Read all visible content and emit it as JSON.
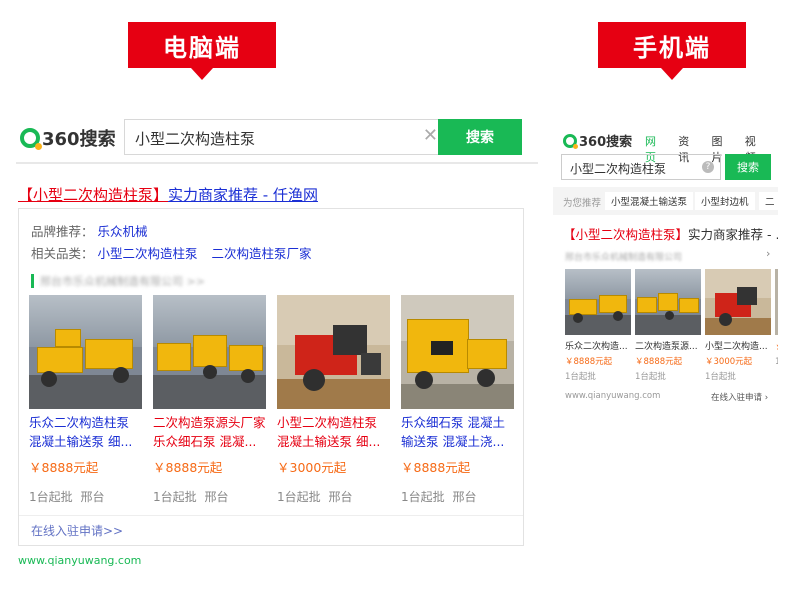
{
  "labels": {
    "desktop": "电脑端",
    "mobile": "手机端"
  },
  "desktop": {
    "logo_text": "360搜索",
    "search_value": "小型二次构造柱泵",
    "clear_glyph": "✕",
    "search_button": "搜索",
    "result_title_highlight": "【小型二次构造柱泵】",
    "result_title_rest": "实力商家推荐 - 仟渔网",
    "brand_label": "品牌推荐：",
    "brand_value": "乐众机械",
    "related_label": "相关品类：",
    "related_items": [
      "小型二次构造柱泵",
      "二次构造柱泵厂家"
    ],
    "company_blurred": "邢台市乐众机械制造有限公司 >>",
    "products": [
      {
        "name": "乐众二次构造柱泵 混凝土输送泵 细...",
        "price": "￥8888元起",
        "meta": "1台起批 邢台",
        "red": false
      },
      {
        "name": "二次构造泵源头厂家 乐众细石泵 混凝...",
        "price": "￥8888元起",
        "meta": "1台起批 邢台",
        "red": true
      },
      {
        "name": "小型二次构造柱泵 混凝土输送泵 细...",
        "price": "￥3000元起",
        "meta": "1台起批 邢台",
        "red": true
      },
      {
        "name": "乐众细石泵 混凝土输送泵 混凝土浇...",
        "price": "￥8888元起",
        "meta": "1台起批 邢台",
        "red": false
      }
    ],
    "apply_link": "在线入驻申请>>",
    "domain": "www.qianyuwang.com"
  },
  "mobile": {
    "logo_text": "360搜索",
    "tabs": [
      "网页",
      "资讯",
      "图片",
      "视频"
    ],
    "active_tab": "网页",
    "search_value": "小型二次构造柱泵",
    "clear_glyph": "?",
    "search_button": "搜索",
    "rec_label": "为您推荐",
    "rec_chips": [
      "小型混凝土输送泵",
      "小型封边机",
      "二"
    ],
    "result_title_highlight": "【小型二次构造柱泵】",
    "result_title_rest": "实力商家推荐 - ...",
    "company_blurred": "邢台市乐众机械制造有限公司",
    "arrow": "›",
    "products": [
      {
        "name": "乐众二次构造...",
        "price": "￥8888元起",
        "meta": "1台起批"
      },
      {
        "name": "二次构造泵源...",
        "price": "￥8888元起",
        "meta": "1台起批"
      },
      {
        "name": "小型二次构造...",
        "price": "￥3000元起",
        "meta": "1台起批"
      },
      {
        "name": "",
        "price": "￥",
        "meta": "1"
      }
    ],
    "domain": "www.qianyuwang.com",
    "apply_link": "在线入驻申请 ›"
  }
}
